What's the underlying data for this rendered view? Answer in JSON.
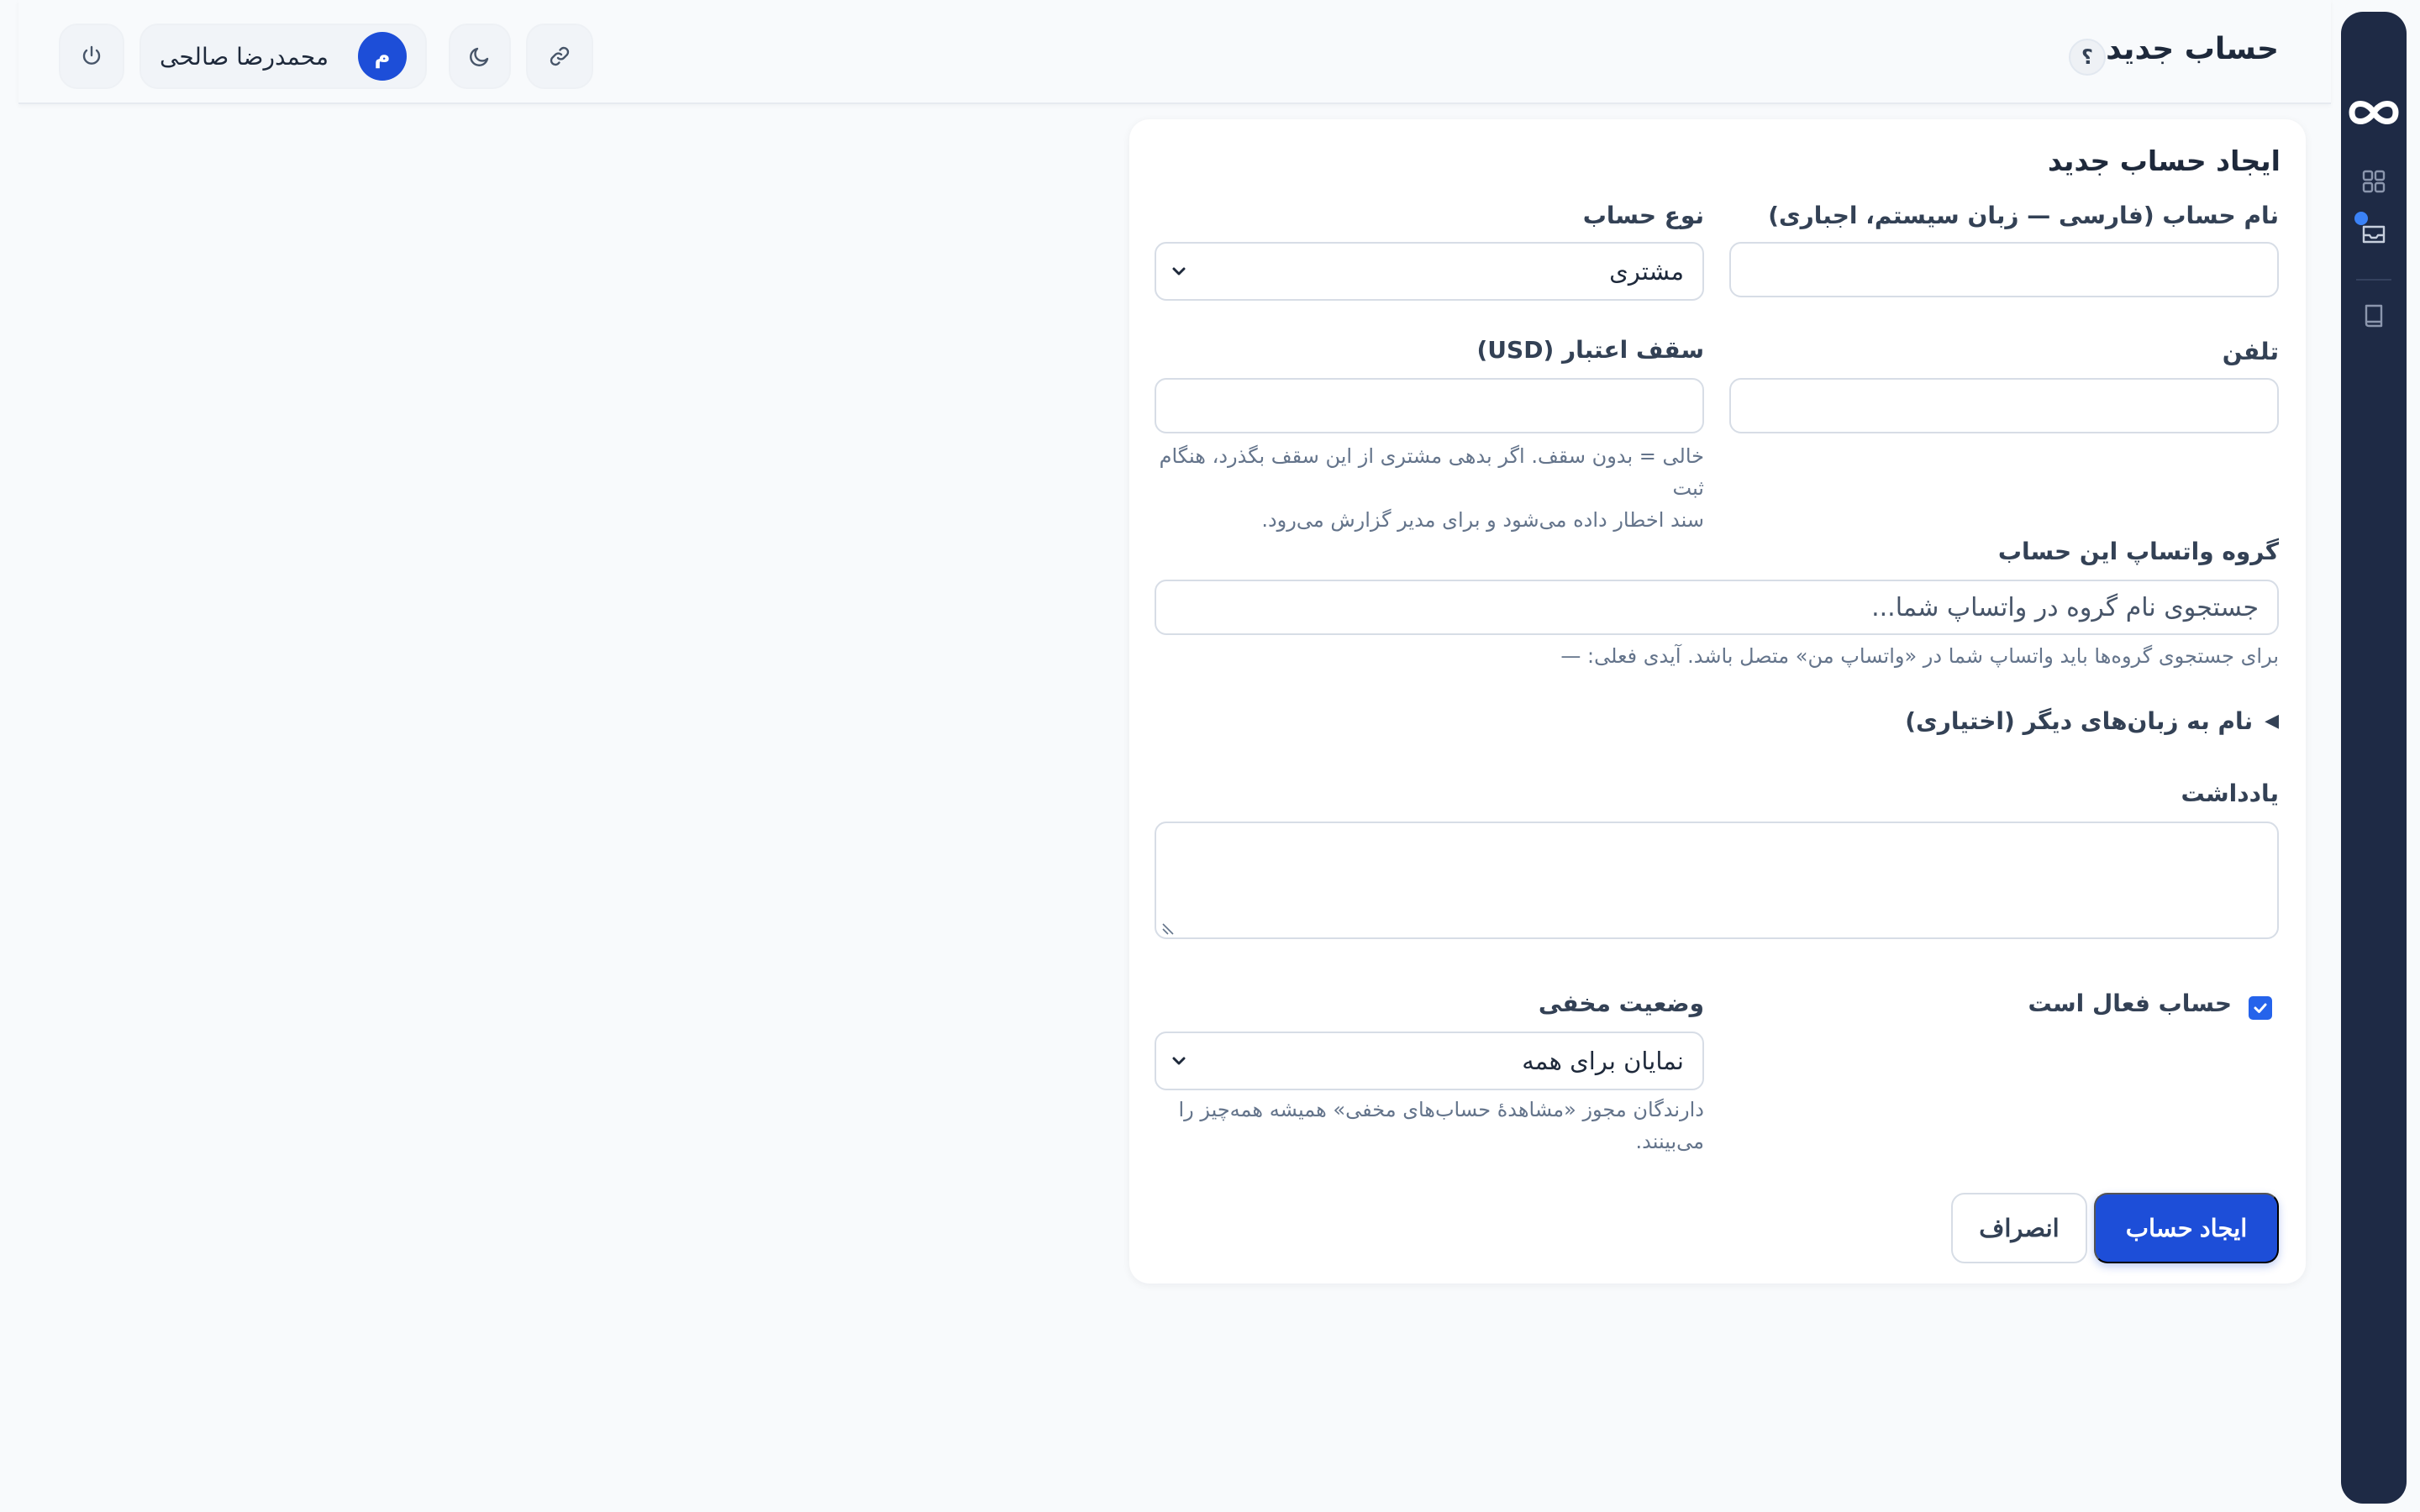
{
  "header": {
    "title": "حساب جدید",
    "help_label": "؟",
    "user_name": "محمدرضا صالحی",
    "avatar_initial": "م"
  },
  "sidebar": {
    "items": [
      {
        "icon": "infinity-logo-icon"
      },
      {
        "icon": "dashboard-grid-icon"
      },
      {
        "icon": "inbox-icon",
        "badge": "notification-dot"
      },
      {
        "icon": "book-icon"
      }
    ]
  },
  "form": {
    "title": "ایجاد حساب جدید",
    "name_label": "نام حساب (فارسی — زبان سیستم، اجباری)",
    "name_value": "",
    "type_label": "نوع حساب",
    "type_value": "مشتری",
    "phone_label": "تلفن",
    "phone_value": "",
    "credit_label": "سقف اعتبار (USD)",
    "credit_value": "",
    "credit_hint_line1": "خالی = بدون سقف. اگر بدهی مشتری از این سقف بگذرد، هنگام ثبت",
    "credit_hint_line2": "سند اخطار داده می‌شود و برای مدیر گزارش می‌رود.",
    "whatsapp_label": "گروه واتساپ این حساب",
    "whatsapp_placeholder": "جستجوی نام گروه در واتساپ شما...",
    "whatsapp_hint": "برای جستجوی گروه‌ها باید واتساپ شما در «واتساپ من» متصل باشد. آیدی فعلی: —",
    "other_lang_label": "نام به زبان‌های دیگر (اختیاری)",
    "note_label": "یادداشت",
    "note_value": "",
    "active_label": "حساب فعال است",
    "active_checked": true,
    "hidden_label": "وضعیت مخفی",
    "hidden_value": "نمایان برای همه",
    "hidden_hint_line1": "دارندگان مجوز «مشاهدهٔ حساب‌های مخفی» همیشه همه‌چیز را",
    "hidden_hint_line2": "می‌بینند.",
    "submit_label": "ایجاد حساب",
    "cancel_label": "انصراف"
  },
  "colors": {
    "primary": "#1d4ed8",
    "sidebar_bg": "#1e2a45",
    "page_bg": "#f8fafc",
    "badge": "#3b82f6"
  }
}
